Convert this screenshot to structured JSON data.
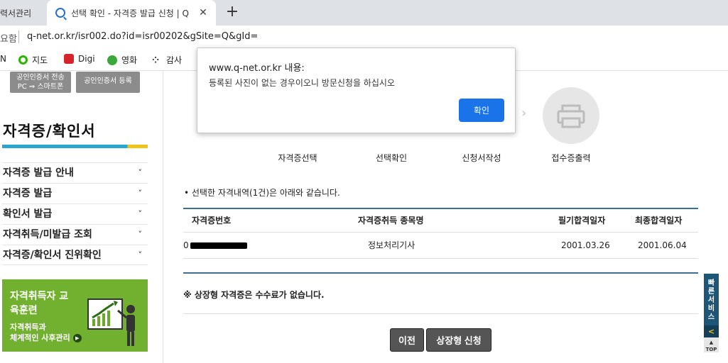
{
  "browser": {
    "prev_tab_title": "력서관리",
    "active_tab_title": "선택 확인 - 자격증 발급 신청 | Q",
    "new_tab_symbol": "+",
    "close_symbol": "✕",
    "secure_label": "요함",
    "url": "q-net.or.kr/isr002.do?id=isr00202&gSite=Q&gId=",
    "bookmarks": [
      {
        "label": "N",
        "icon": "naver-icon"
      },
      {
        "label": "지도",
        "icon": "map-pin-icon"
      },
      {
        "label": "Digi",
        "icon": "digi-icon"
      },
      {
        "label": "영화",
        "icon": "movie-icon"
      },
      {
        "label": "감사",
        "icon": "dots-icon"
      }
    ]
  },
  "cert_buttons": {
    "transfer_line1": "공인인증서 전송",
    "transfer_line2": "PC ⇒ 스마트폰",
    "register": "공인인증서 등록"
  },
  "sidebar": {
    "title": "자격증/확인서",
    "items": [
      {
        "label": "자격증 발급 안내"
      },
      {
        "label": "자격증 발급"
      },
      {
        "label": "확인서 발급"
      },
      {
        "label": "자격취득/미발급 조회"
      },
      {
        "label": "자격증/확인서 진위확인"
      }
    ],
    "chevron": "˅",
    "banner": {
      "title": "자격취득자 교육훈련",
      "sub_line1": "자격취득과",
      "sub_line2": "체계적인 사후관리",
      "arrow": "▶"
    }
  },
  "steps": [
    {
      "label": "자격증선택",
      "active": false
    },
    {
      "label": "선택확인",
      "active": true
    },
    {
      "label": "신청서작성",
      "active": false
    },
    {
      "label": "접수증출력",
      "active": false
    }
  ],
  "step_arrow": "›",
  "intro_text": "• 선택한 자격내역(1건)은 아래와 같습니다.",
  "table": {
    "headers": [
      "자격증번호",
      "자격증취득 종목명",
      "필기합격일자",
      "최종합격일자"
    ],
    "rows": [
      {
        "number_prefix": "0",
        "name": "정보처리기사",
        "written_date": "2001.03.26",
        "final_date": "2001.06.04"
      }
    ]
  },
  "notice": "※ 상장형 자격증은 수수료가 없습니다.",
  "buttons": {
    "prev": "이전",
    "apply": "상장형 신청"
  },
  "quick_service": {
    "label": "빠른서비스",
    "toggle": "<",
    "top": "TOP"
  },
  "dialog": {
    "title": "www.q-net.or.kr 내용:",
    "message": "등록된 사진이 없는 경우이오니 방문신청을 하십시오",
    "ok": "확인"
  },
  "colors": {
    "accent_blue": "#1a73e8",
    "step_active": "#2d8ac6",
    "table_line": "#3e6e95",
    "banner_green": "#72b02f"
  }
}
